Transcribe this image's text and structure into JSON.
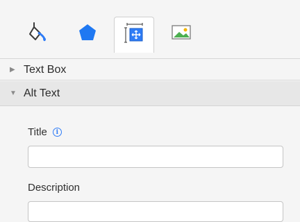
{
  "toolbar": {
    "tabs": [
      {
        "icon": "paint-bucket-icon",
        "selected": false
      },
      {
        "icon": "pentagon-shape-icon",
        "selected": false
      },
      {
        "icon": "size-position-icon",
        "selected": true
      },
      {
        "icon": "picture-icon",
        "selected": false
      }
    ]
  },
  "sections": {
    "text_box": {
      "label": "Text Box",
      "expanded": false
    },
    "alt_text": {
      "label": "Alt Text",
      "expanded": true
    }
  },
  "alt_text": {
    "title_label": "Title",
    "title_value": "",
    "description_label": "Description",
    "description_value": ""
  },
  "colors": {
    "accent": "#2f7cf6",
    "panel_background": "#f5f5f5",
    "selected_header": "#e7e7e7"
  }
}
